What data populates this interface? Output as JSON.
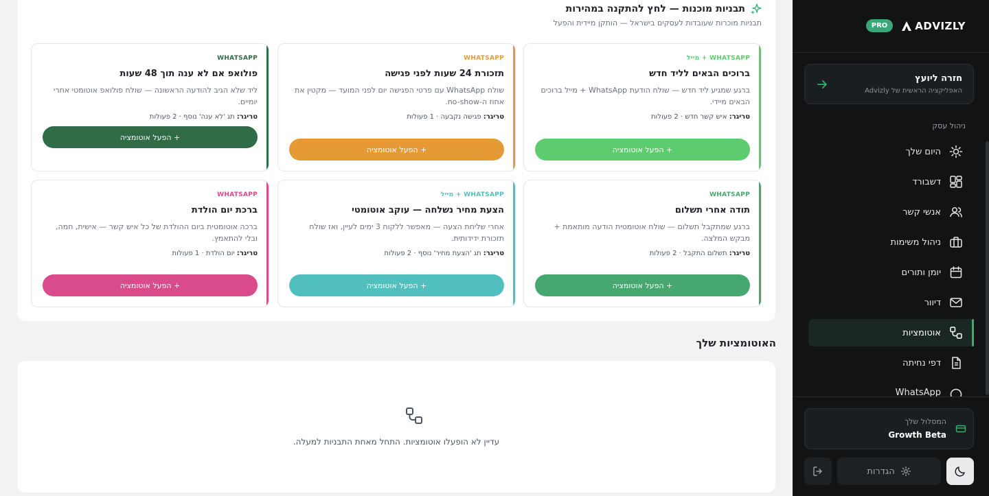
{
  "templates": {
    "title": "תבניות מוכנות — לחץ להתקנה במהירות",
    "subtitle": "תבניות מוכרות שעובדות לעסקים בישראל — הותקן מיידית והפעל",
    "trigger_prefix": "טריגר:",
    "cards": [
      {
        "channel": "WHATSAPP + מייל",
        "title": "ברוכים הבאים לליד חדש",
        "desc": "ברגע שמגיע ליד חדש — שולח הודעת WhatsApp + מייל ברוכים הבאים מיידי.",
        "trigger": "איש קשר חדש · 2 פעולות",
        "button": "+ הפעל אוטומציה",
        "accent": "#5ccc6e"
      },
      {
        "channel": "WHATSAPP",
        "title": "תזכורת 24 שעות לפני פגישה",
        "desc": "שולח WhatsApp עם פרטי הפגישה יום לפני המועד — מקטין את אחוז ה-no-show.",
        "trigger": "פגישה נקבעה · 1 פעולות",
        "button": "+ הפעל אוטומציה",
        "accent": "#e69a35"
      },
      {
        "channel": "WHATSAPP",
        "title": "פולואפ אם לא ענה תוך 48 שעות",
        "desc": "ליד שלא הגיב להודעה הראשונה — שולח פולואפ אוטומטי אחרי יומיים.",
        "trigger": "תג 'לא ענה' נוסף · 2 פעולות",
        "button": "+ הפעל אוטומציה",
        "accent": "#2f6b47"
      },
      {
        "channel": "WHATSAPP",
        "title": "תודה אחרי תשלום",
        "desc": "ברגע שמתקבל תשלום — שולח אוטומטית הודעה מותאמת + מבקש המלצה.",
        "trigger": "תשלום התקבל · 2 פעולות",
        "button": "+ הפעל אוטומציה",
        "accent": "#46a86f"
      },
      {
        "channel": "WHATSAPP + מייל",
        "title": "הצעת מחיר נשלחה — עוקב אוטומטי",
        "desc": "אחרי שליחת הצעה — מאפשר ללקוח 3 ימים לעיין, ואז שולח תזכורת ידידותית.",
        "trigger": "תג 'הצעת מחיר' נוסף · 2 פעולות",
        "button": "+ הפעל אוטומציה",
        "accent": "#52bfbf"
      },
      {
        "channel": "WHATSAPP",
        "title": "ברכת יום הולדת",
        "desc": "ברכה אוטומטית ביום ההולדת של כל איש קשר — אישית, חמה, ובלי להתאמץ.",
        "trigger": "יום הולדת · 1 פעולות",
        "button": "+ הפעל אוטומציה",
        "accent": "#d94b8a"
      }
    ]
  },
  "my_automations": {
    "title": "האוטומציות שלך",
    "empty_text": "עדיין לא הופעלו אוטומציות. התחל מאחת התבניות למעלה."
  },
  "sidebar": {
    "logo": "ADVIZLY",
    "badge": "PRO",
    "back": {
      "title": "חזרה ליועץ",
      "subtitle": "האפליקציה הראשית של Advizly"
    },
    "section": "ניהול עסק",
    "items": [
      {
        "label": "היום שלך",
        "icon": "sun-icon"
      },
      {
        "label": "דשבורד",
        "icon": "dashboard-icon"
      },
      {
        "label": "אנשי קשר",
        "icon": "users-icon"
      },
      {
        "label": "ניהול משימות",
        "icon": "briefcase-icon"
      },
      {
        "label": "יומן ותורים",
        "icon": "calendar-icon"
      },
      {
        "label": "דיוור",
        "icon": "mail-icon"
      },
      {
        "label": "אוטומציות",
        "icon": "workflow-icon",
        "active": true
      },
      {
        "label": "דפי נחיתה",
        "icon": "document-icon"
      },
      {
        "label": "WhatsApp",
        "icon": "chat-icon"
      }
    ],
    "plan": {
      "label": "המסלול שלך",
      "value": "Growth Beta"
    },
    "settings": "הגדרות"
  },
  "colors": {
    "accent": "#2fb36f",
    "sidebar_bg": "#111315",
    "page_bg": "#f1f2f4"
  }
}
